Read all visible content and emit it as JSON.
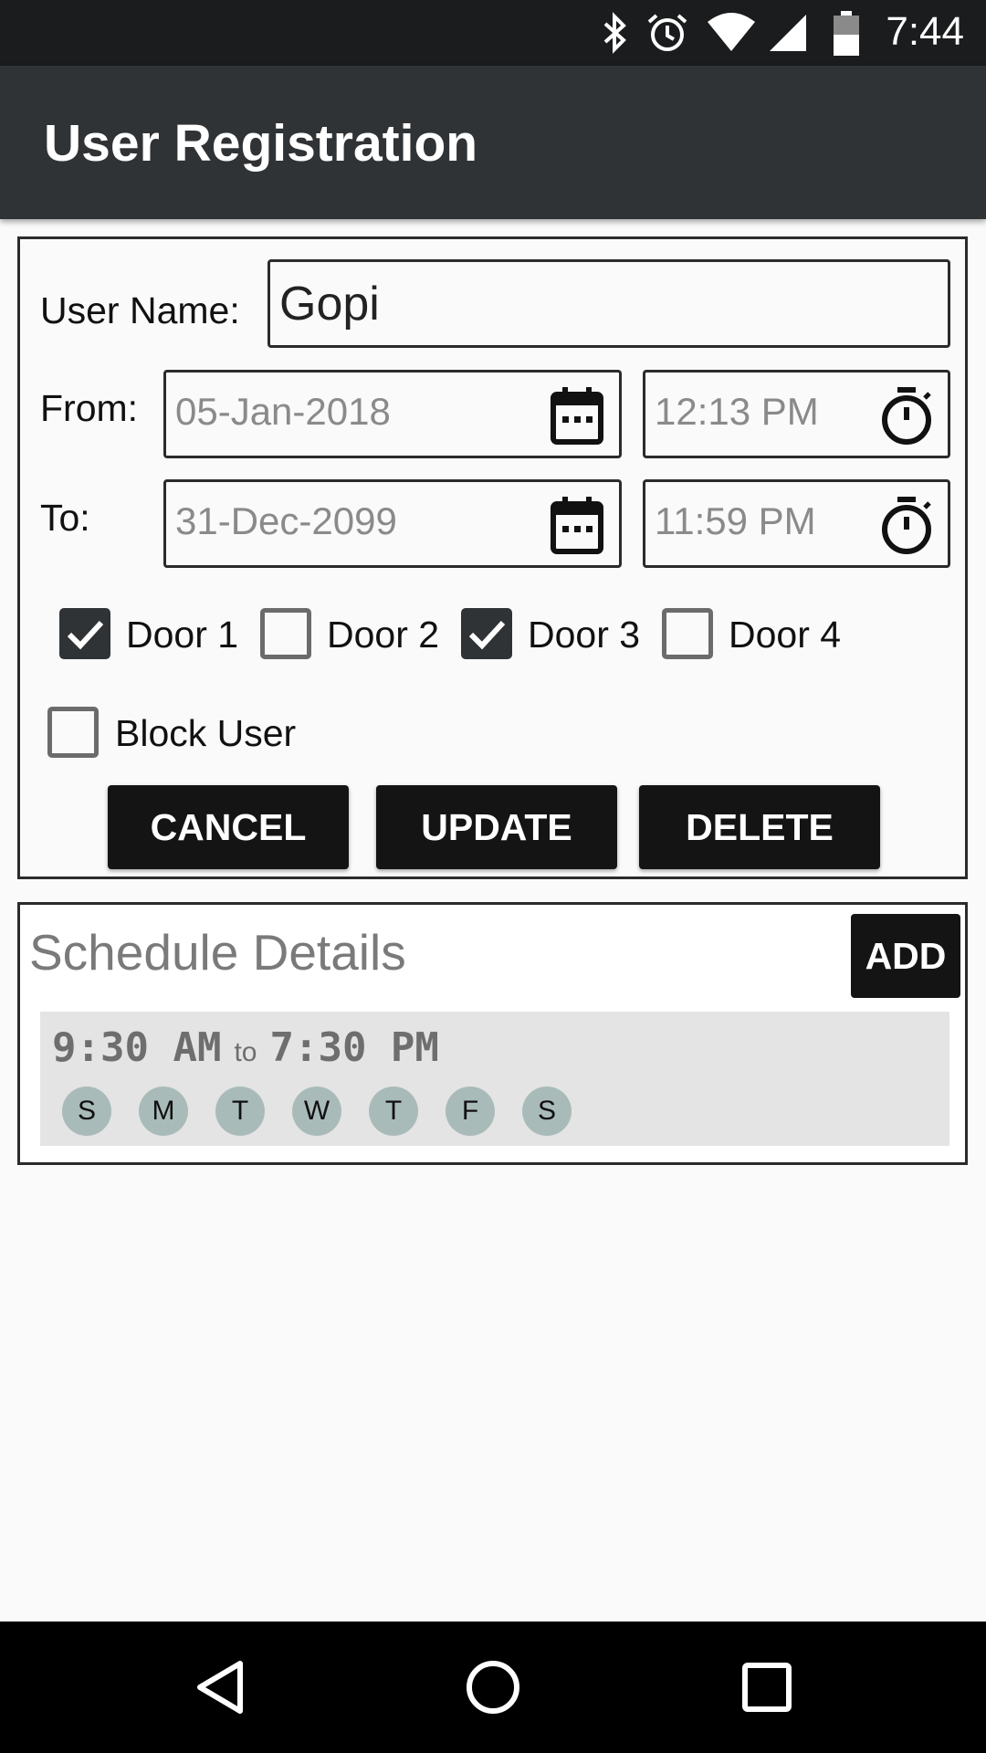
{
  "status_bar": {
    "time": "7:44",
    "icons": [
      "bluetooth-icon",
      "alarm-icon",
      "wifi-icon",
      "signal-icon",
      "battery-icon"
    ]
  },
  "app_bar": {
    "title": "User Registration"
  },
  "form": {
    "user_name_label": "User Name:",
    "user_name_value": "Gopi",
    "from_label": "From:",
    "from_date": "05-Jan-2018",
    "from_time": "12:13 PM",
    "to_label": "To:",
    "to_date": "31-Dec-2099",
    "to_time": "11:59 PM",
    "doors": [
      {
        "label": "Door 1",
        "checked": true
      },
      {
        "label": "Door 2",
        "checked": false
      },
      {
        "label": "Door 3",
        "checked": true
      },
      {
        "label": "Door 4",
        "checked": false
      }
    ],
    "block_user": {
      "label": "Block User",
      "checked": false
    },
    "buttons": {
      "cancel": "CANCEL",
      "update": "UPDATE",
      "delete": "DELETE"
    }
  },
  "schedule": {
    "title": "Schedule Details",
    "add_label": "ADD",
    "items": [
      {
        "start": "9:30 AM",
        "to": "to",
        "end": "7:30 PM",
        "days": [
          "S",
          "M",
          "T",
          "W",
          "T",
          "F",
          "S"
        ]
      }
    ]
  },
  "colors": {
    "app_bar": "#303336",
    "button": "#141414",
    "day_chip": "#a9bbb9",
    "schedule_item_bg": "#e4e4e4"
  }
}
